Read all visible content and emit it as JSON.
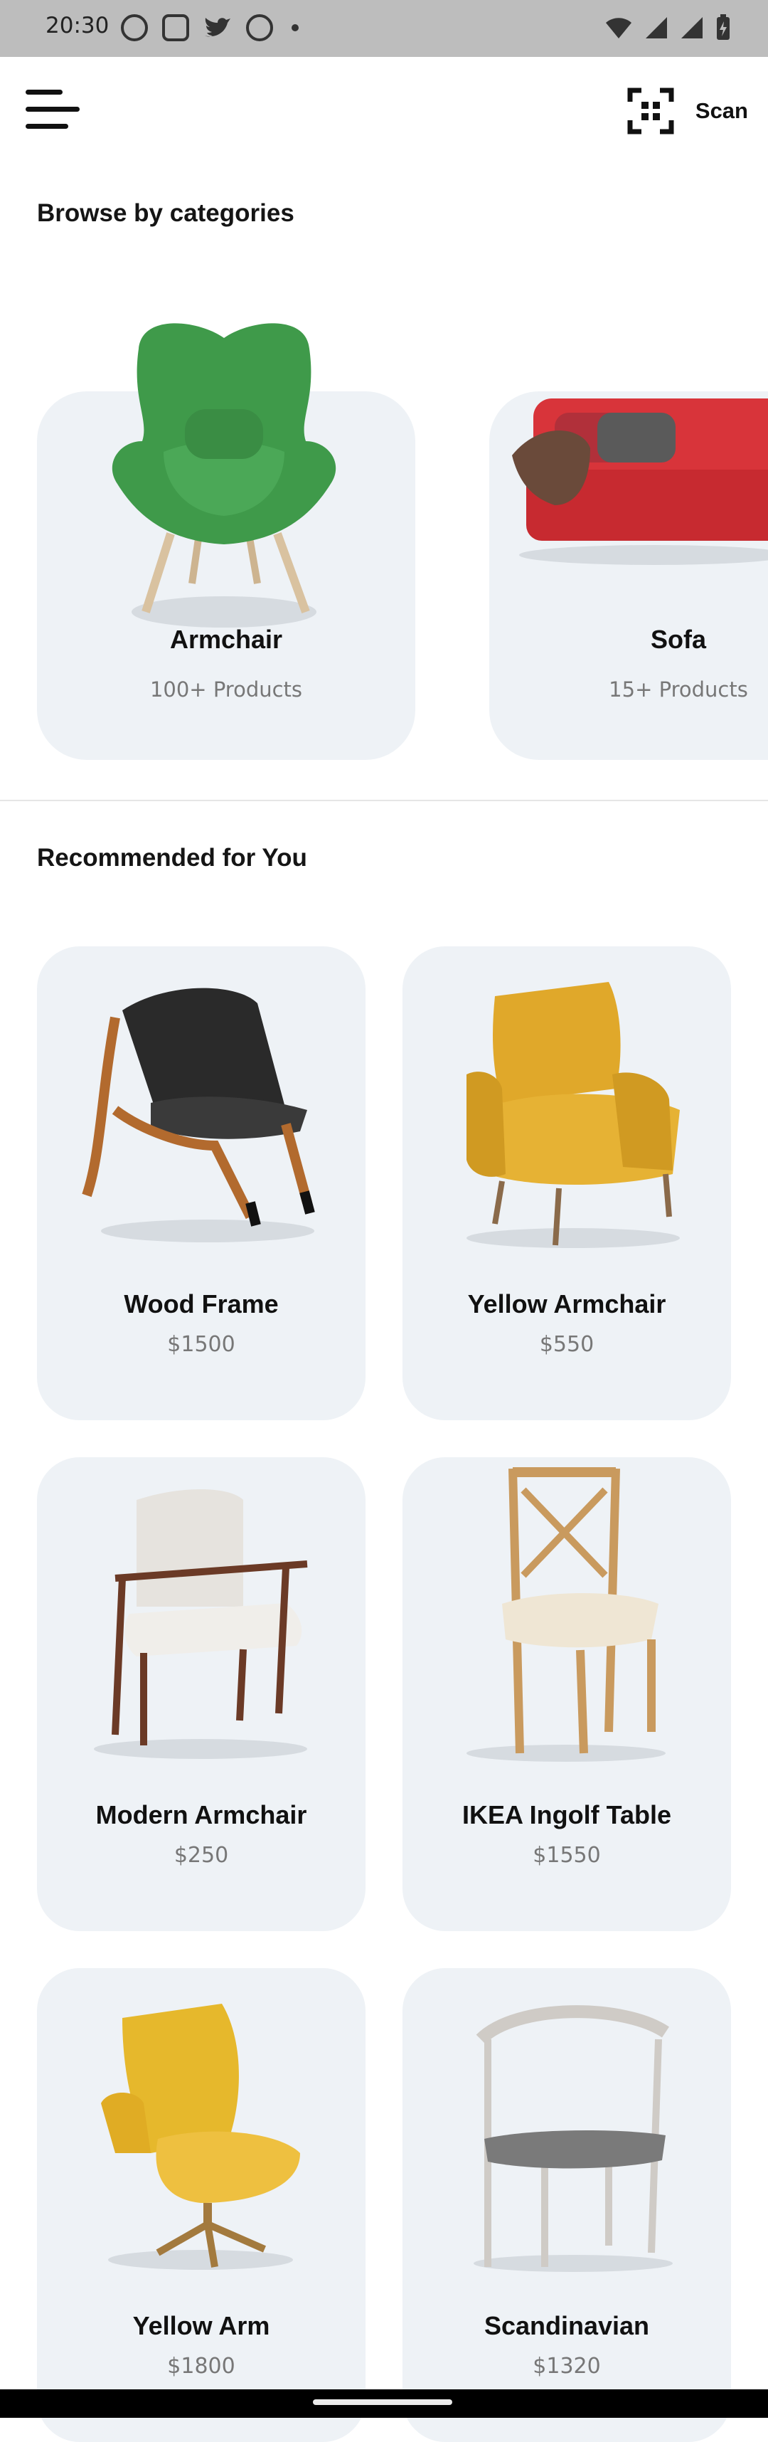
{
  "status_bar": {
    "time": "20:30",
    "left_icons": [
      "whatsapp-icon",
      "instagram-icon",
      "twitter-icon",
      "blocked-icon"
    ],
    "right_icons": [
      "wifi-icon",
      "signal-icon",
      "battery-icon"
    ]
  },
  "app_bar": {
    "menu_icon": "menu-icon",
    "scan_icon": "scan-icon",
    "scan_label": "Scan"
  },
  "categories": {
    "title": "Browse by categories",
    "items": [
      {
        "name": "Armchair",
        "count": "100+ Products",
        "color": "#3f9a4a"
      },
      {
        "name": "Sofa",
        "count": "15+ Products",
        "color": "#d8343a"
      }
    ]
  },
  "recommended": {
    "title": "Recommended for You",
    "items": [
      {
        "name": "Wood Frame",
        "price": "$1500",
        "color": "#2a2a2a"
      },
      {
        "name": "Yellow Armchair",
        "price": "$550",
        "color": "#e0a82a"
      },
      {
        "name": "Modern Armchair",
        "price": "$250",
        "color": "#e6e3de"
      },
      {
        "name": "IKEA Ingolf Table",
        "price": "$1550",
        "color": "#c99a5e"
      },
      {
        "name": "Yellow Arm",
        "price": "$1800",
        "color": "#e6b82c"
      },
      {
        "name": "Scandinavian",
        "price": "$1320",
        "color": "#7a7a7a"
      }
    ]
  },
  "theme": {
    "card_bg": "#eef2f6",
    "text_primary": "#111111",
    "text_secondary": "#777777"
  }
}
